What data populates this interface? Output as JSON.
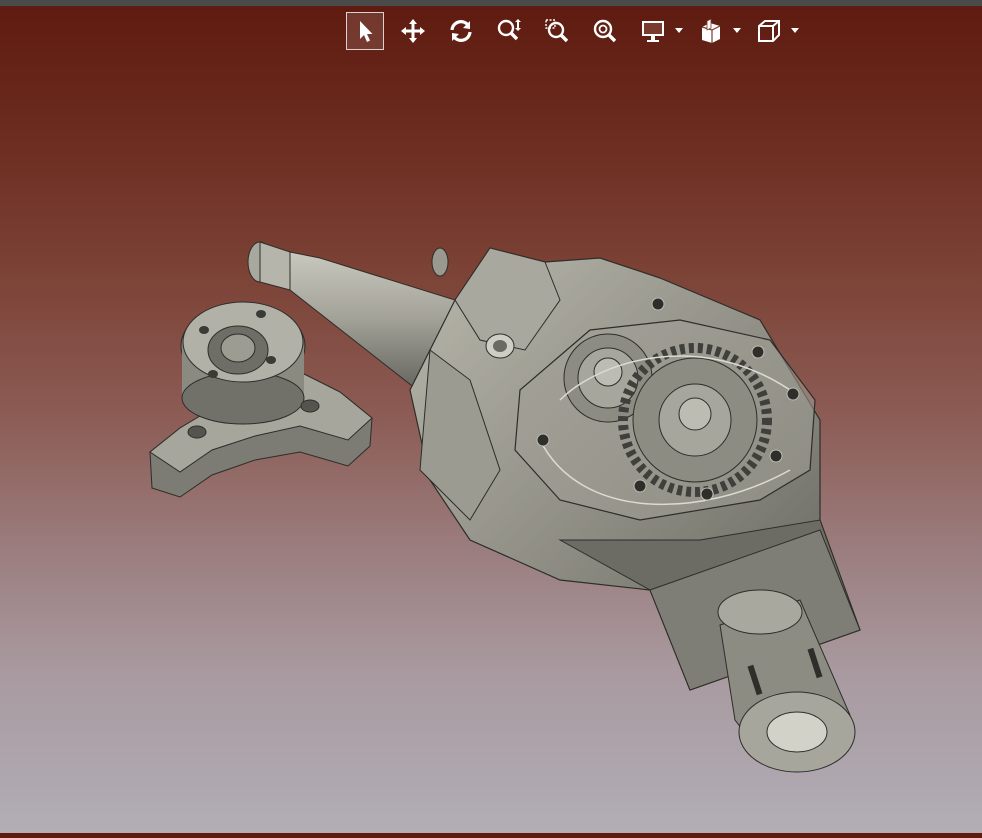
{
  "toolbar": {
    "buttons": [
      {
        "name": "select-tool",
        "icon": "cursor-icon",
        "active": true
      },
      {
        "name": "pan-tool",
        "icon": "move-arrows-icon",
        "active": false
      },
      {
        "name": "rotate-tool",
        "icon": "rotate-icon",
        "active": false
      },
      {
        "name": "zoom-tool",
        "icon": "zoom-icon",
        "active": false
      },
      {
        "name": "zoom-window-tool",
        "icon": "zoom-window-icon",
        "active": false
      },
      {
        "name": "zoom-fit-tool",
        "icon": "zoom-fit-icon",
        "active": false
      },
      {
        "name": "display-mode",
        "icon": "monitor-icon",
        "dropdown": true
      },
      {
        "name": "section-view",
        "icon": "section-cube-icon",
        "dropdown": true
      },
      {
        "name": "view-orientation",
        "icon": "cube-icon",
        "dropdown": true
      }
    ]
  },
  "colors": {
    "background_top": "#5e1a0e",
    "background_bottom": "#b2adb6",
    "model_gray": "#8a8a80",
    "icon_white": "#ffffff"
  }
}
